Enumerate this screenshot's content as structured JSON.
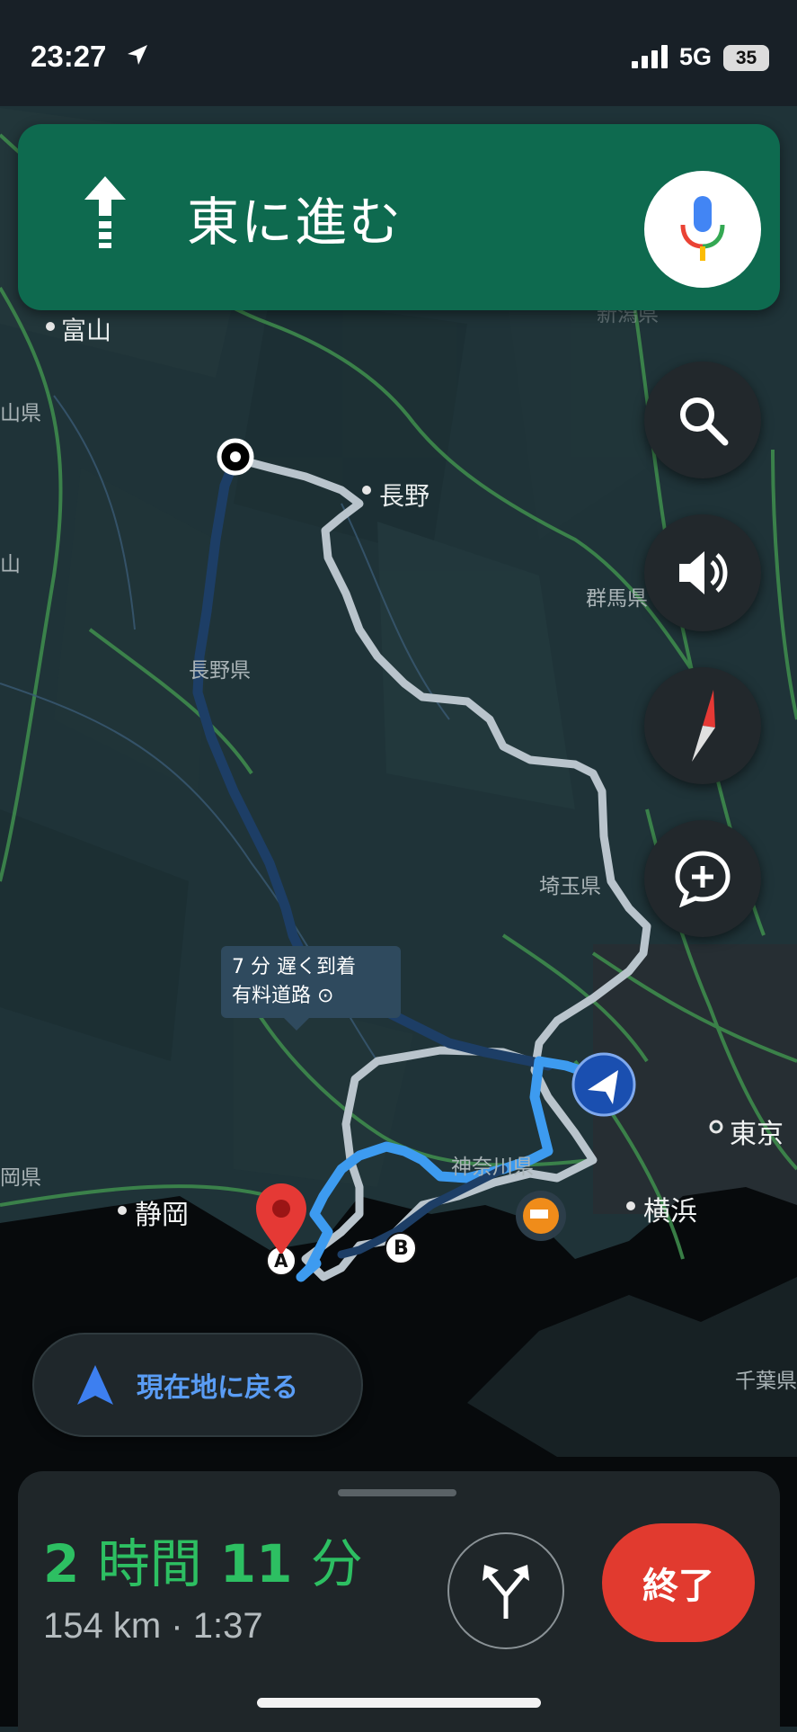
{
  "status": {
    "time": "23:27",
    "network": "5G",
    "battery": "35"
  },
  "nav": {
    "instruction": "東に進む"
  },
  "map": {
    "labels": {
      "toyama": "富山",
      "yamaken": "山県",
      "yama": "山",
      "nagano": "長野",
      "nagano_pref": "長野県",
      "gunma": "群馬県",
      "saitama": "埼玉県",
      "kanagawa": "神奈川県",
      "tokyo": "東京",
      "yokohama": "横浜",
      "shizuoka": "静岡",
      "chiba": "千葉県",
      "okenken": "岡県",
      "niigata": "新潟県"
    },
    "callout": {
      "line1": "7 分 遅く到着",
      "line2": "有料道路"
    },
    "markers": {
      "a": "A",
      "b": "B"
    }
  },
  "recenter": {
    "label": "現在地に戻る"
  },
  "trip": {
    "hours": "2",
    "hours_unit": "時間",
    "minutes": "11",
    "minutes_unit": "分",
    "details": "154 km · 1:37"
  },
  "end_button": {
    "label": "終了"
  },
  "colors": {
    "banner": "#0e6a4f",
    "eta_green": "#2dbf62",
    "end_red": "#e13a2f",
    "route_blue": "#3d9bf0",
    "alt_route": "#b9c4cc"
  },
  "icons": [
    "location-arrow-icon",
    "signal-icon",
    "straight-arrow-icon",
    "mic-icon",
    "search-icon",
    "volume-icon",
    "compass-icon",
    "add-report-icon",
    "navigation-arrow-icon",
    "alternate-routes-icon",
    "destination-pin-icon",
    "camera-icon"
  ]
}
